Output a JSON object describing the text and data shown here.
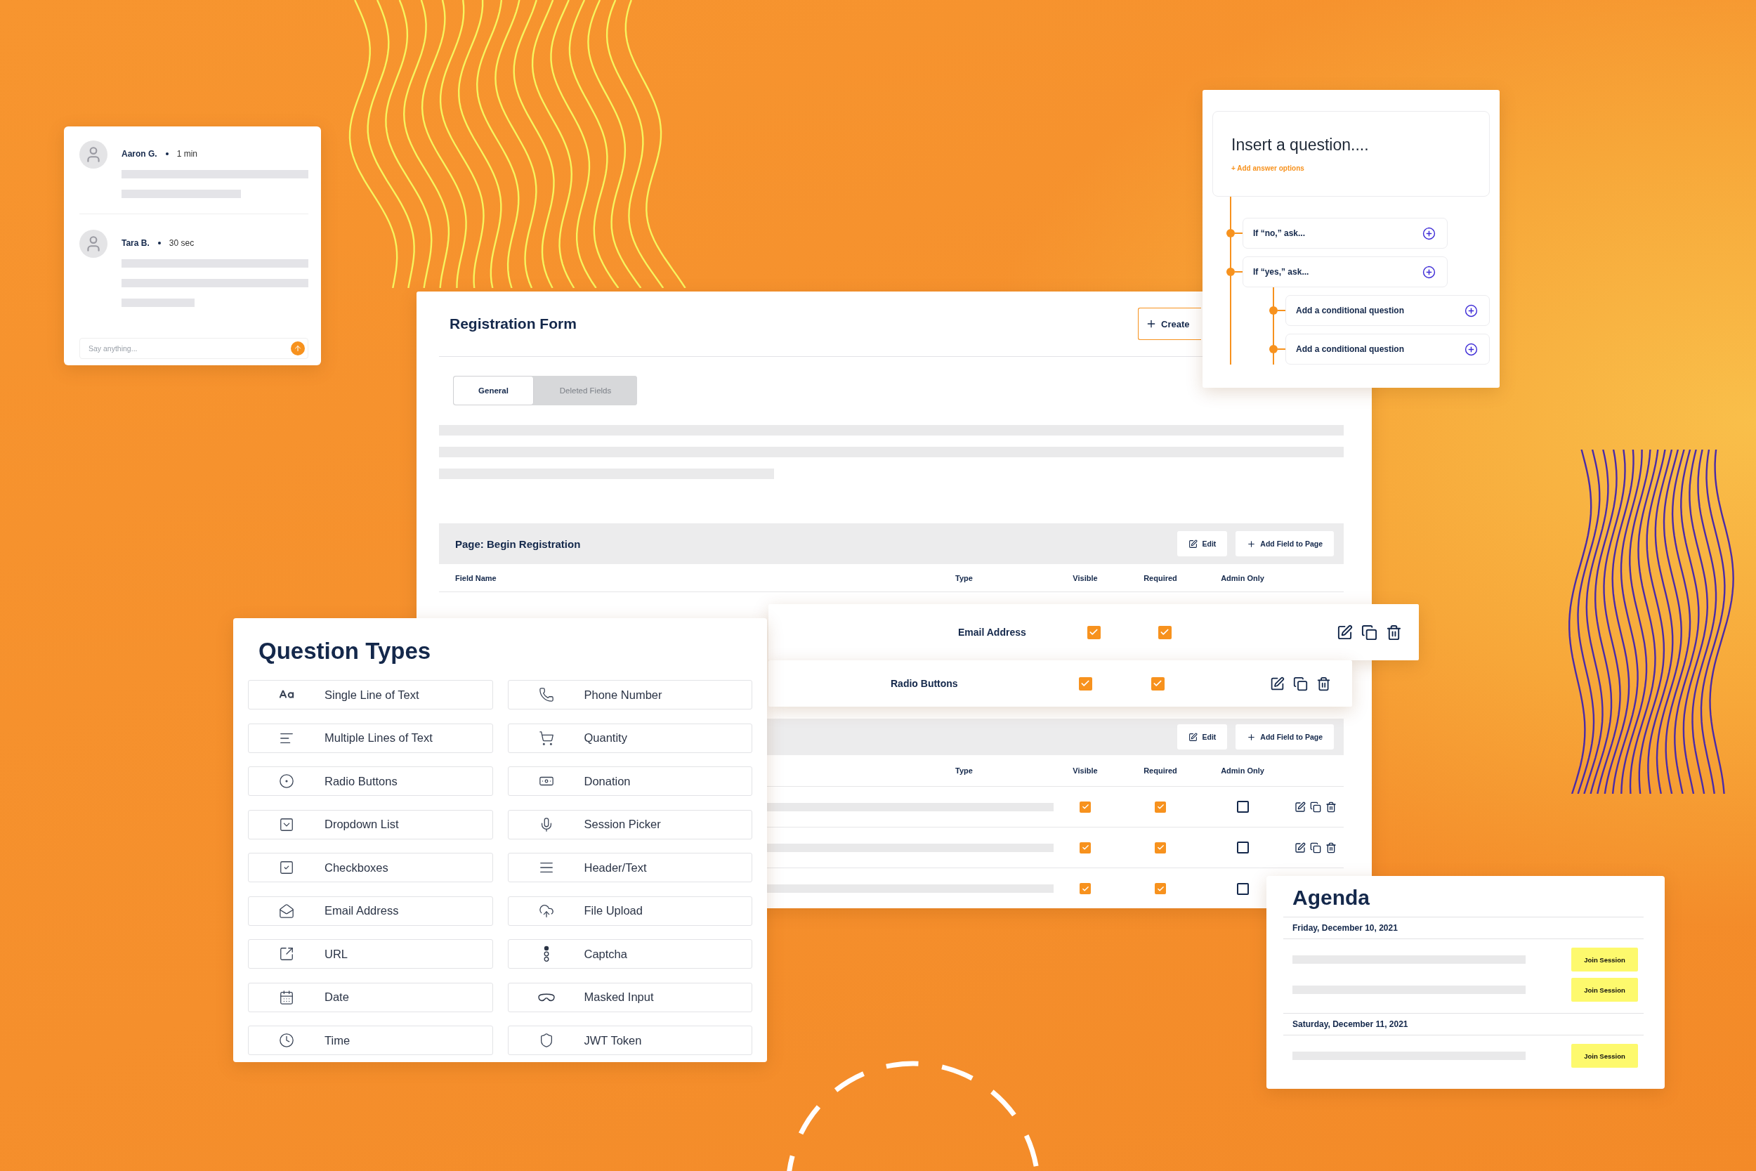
{
  "chat": {
    "messages": [
      {
        "author": "Aaron G.",
        "time": "1 min"
      },
      {
        "author": "Tara B.",
        "time": "30 sec"
      }
    ],
    "input": {
      "placeholder": "Say anything..."
    }
  },
  "question_builder": {
    "prompt": "Insert a question....",
    "add_link": "+ Add answer options",
    "branches": [
      {
        "label": "If “no,” ask..."
      },
      {
        "label": "If “yes,” ask...",
        "children": [
          {
            "label": "Add a conditional question"
          },
          {
            "label": "Add a conditional question"
          }
        ]
      }
    ]
  },
  "registration_form": {
    "title": "Registration Form",
    "create_button": "Create",
    "tabs": [
      {
        "label": "General",
        "selected": true
      },
      {
        "label": "Deleted Fields",
        "selected": false
      }
    ],
    "sections": [
      {
        "title": "Page: Begin Registration",
        "buttons": [
          "Edit",
          "Add Field to Page"
        ],
        "columns": {
          "field_name": "Field Name",
          "type": "Type",
          "visible": "Visible",
          "required": "Required",
          "admin_only": "Admin Only"
        }
      },
      {
        "buttons": [
          "Edit",
          "Add Field to Page"
        ],
        "columns": {
          "type": "Type",
          "visible": "Visible",
          "required": "Required",
          "admin_only": "Admin Only"
        },
        "rows": [
          {
            "visible": true,
            "required": true,
            "admin_only": false
          },
          {
            "visible": true,
            "required": true,
            "admin_only": false
          },
          {
            "visible": true,
            "required": true,
            "admin_only": false
          }
        ]
      }
    ]
  },
  "dragged_rows": [
    {
      "type": "Email Address",
      "visible": true,
      "required": true
    },
    {
      "type": "Radio Buttons",
      "visible": true,
      "required": true
    }
  ],
  "question_types": {
    "title": "Question Types",
    "items": [
      {
        "label": "Single Line of Text",
        "kind": "text"
      },
      {
        "label": "Phone Number",
        "kind": "phone"
      },
      {
        "label": "Multiple Lines of Text",
        "kind": "paragraph"
      },
      {
        "label": "Quantity",
        "kind": "cart"
      },
      {
        "label": "Radio Buttons",
        "kind": "radio"
      },
      {
        "label": "Donation",
        "kind": "money"
      },
      {
        "label": "Dropdown List",
        "kind": "dropdown"
      },
      {
        "label": "Session Picker",
        "kind": "mic"
      },
      {
        "label": "Checkboxes",
        "kind": "checkbox"
      },
      {
        "label": "Header/Text",
        "kind": "header"
      },
      {
        "label": "Email Address",
        "kind": "email"
      },
      {
        "label": "File Upload",
        "kind": "upload"
      },
      {
        "label": "URL",
        "kind": "url"
      },
      {
        "label": "Captcha",
        "kind": "captcha"
      },
      {
        "label": "Date",
        "kind": "date"
      },
      {
        "label": "Masked Input",
        "kind": "mask"
      },
      {
        "label": "Time",
        "kind": "time"
      },
      {
        "label": "JWT Token",
        "kind": "shield"
      }
    ]
  },
  "agenda": {
    "title": "Agenda",
    "days": [
      {
        "date": "Friday, December 10, 2021",
        "sessions": [
          {
            "button": "Join Session"
          },
          {
            "button": "Join Session"
          }
        ]
      },
      {
        "date": "Saturday, December 11, 2021",
        "sessions": [
          {
            "button": "Join Session"
          }
        ]
      }
    ]
  }
}
